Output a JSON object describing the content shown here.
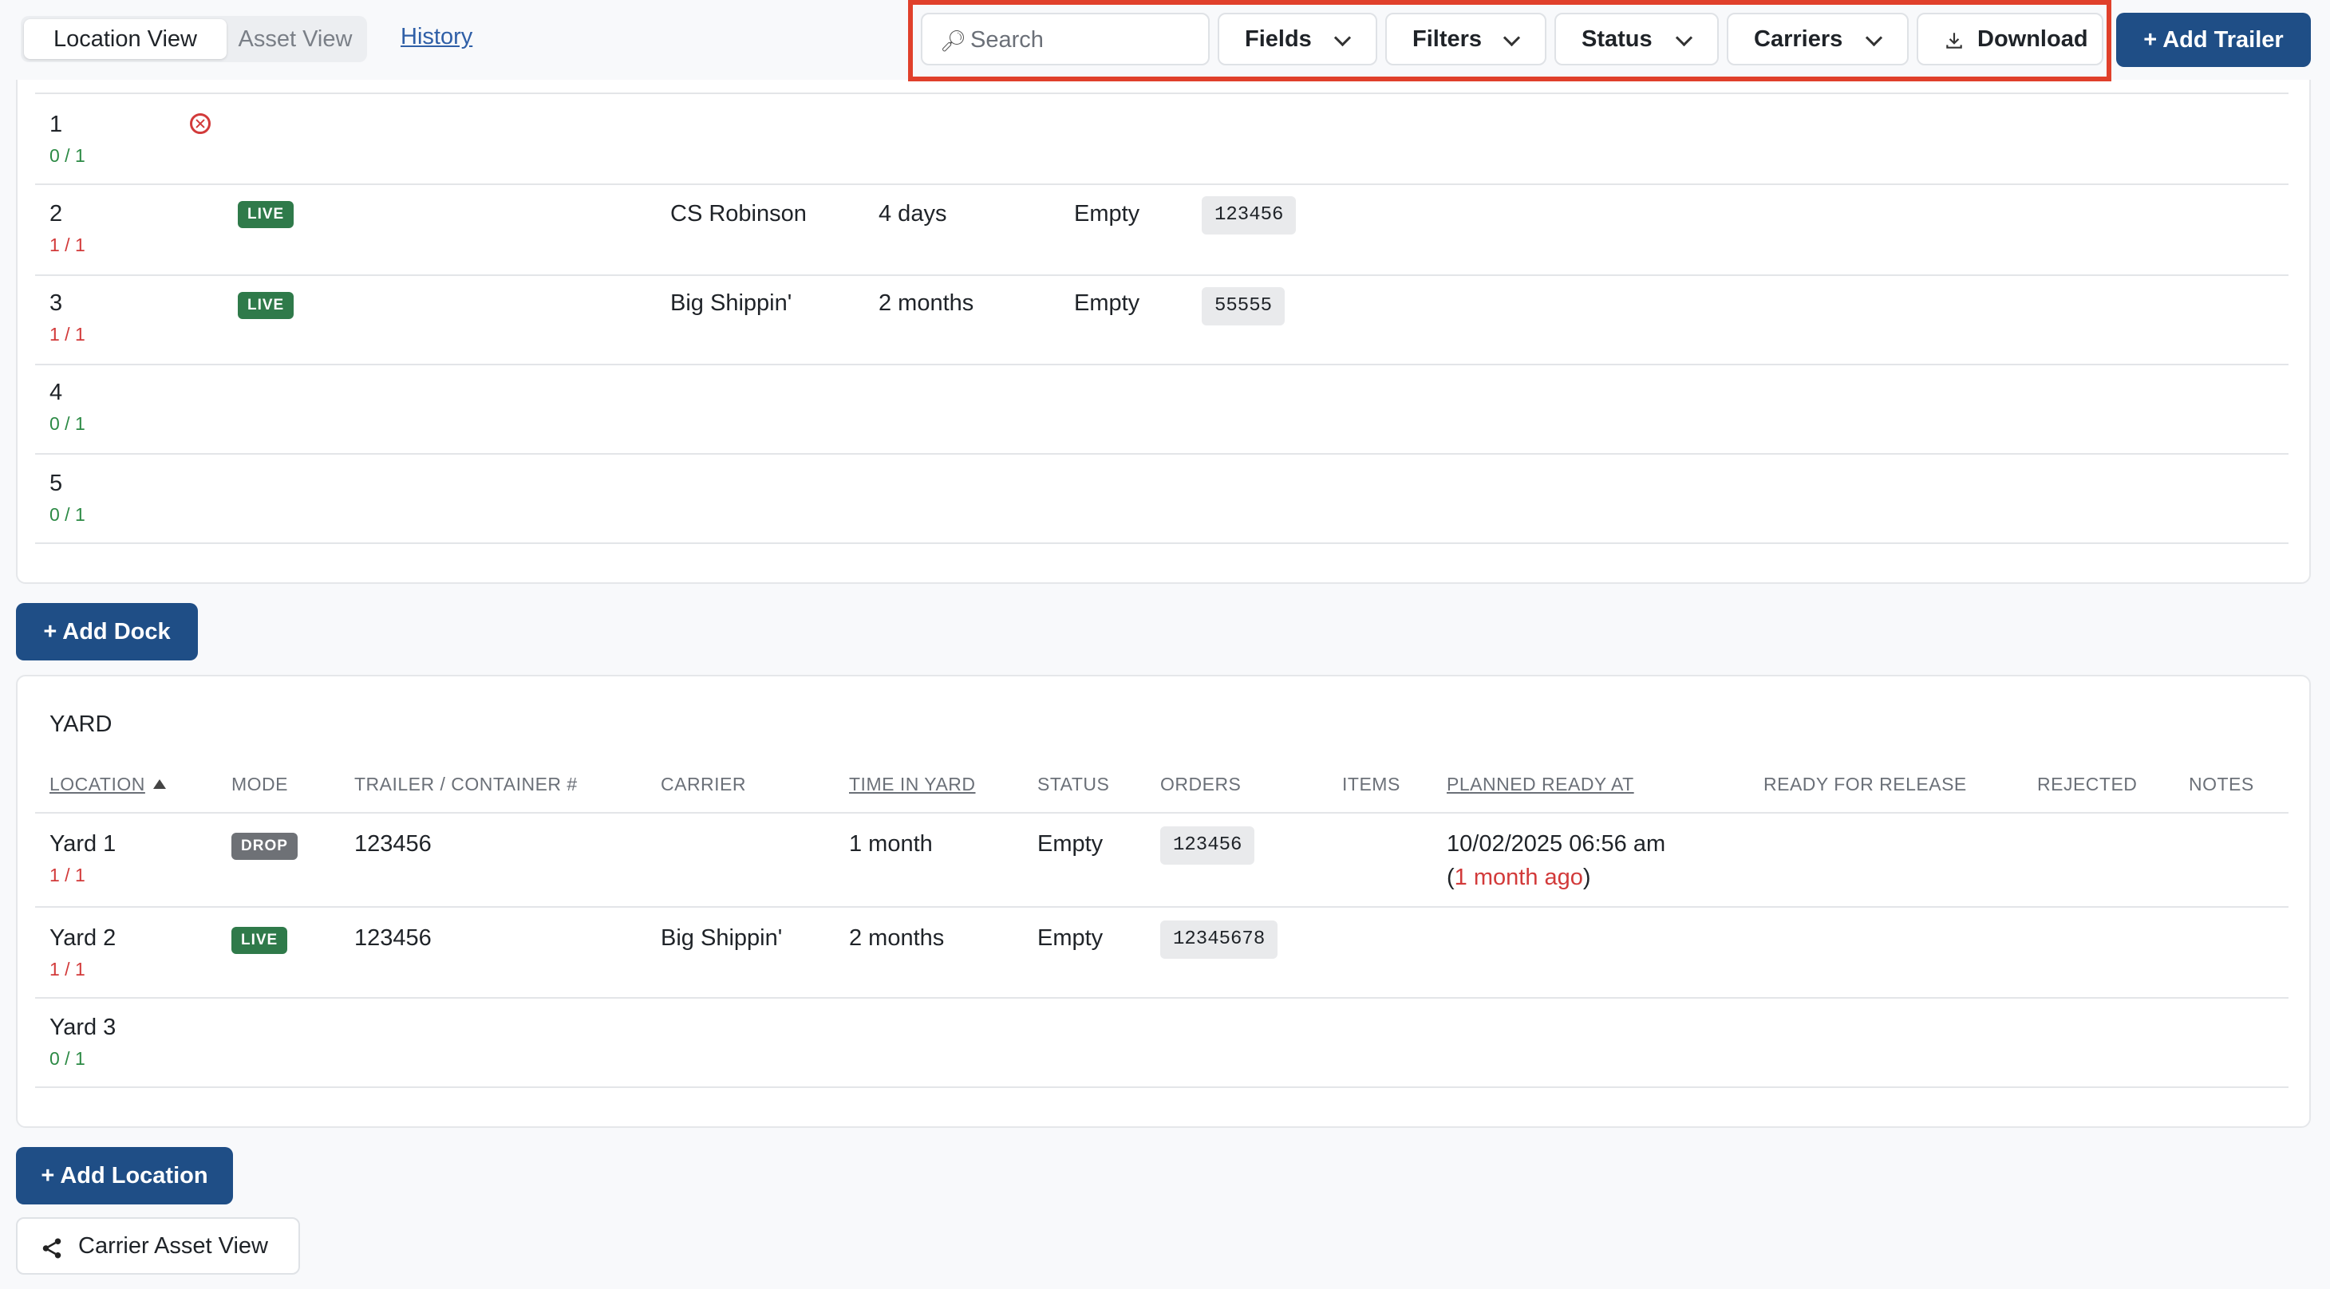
{
  "toolbar": {
    "view_tabs": [
      "Location View",
      "Asset View"
    ],
    "history_label": "History",
    "search_placeholder": "Search",
    "fields_label": "Fields",
    "filters_label": "Filters",
    "status_label": "Status",
    "carriers_label": "Carriers",
    "download_label": "Download",
    "add_trailer_label": "+ Add Trailer"
  },
  "docks": [
    {
      "location": "1",
      "occupancy": "0 / 1",
      "occupancy_color": "green",
      "status_icon": "error-circle-x-icon"
    },
    {
      "location": "2",
      "occupancy": "1 / 1",
      "occupancy_color": "red",
      "mode": "LIVE",
      "carrier": "CS Robinson",
      "time_in_yard": "4 days",
      "status": "Empty",
      "order": "123456"
    },
    {
      "location": "3",
      "occupancy": "1 / 1",
      "occupancy_color": "red",
      "mode": "LIVE",
      "carrier": "Big Shippin'",
      "time_in_yard": "2 months",
      "status": "Empty",
      "order": "55555"
    },
    {
      "location": "4",
      "occupancy": "0 / 1",
      "occupancy_color": "green"
    },
    {
      "location": "5",
      "occupancy": "0 / 1",
      "occupancy_color": "green"
    }
  ],
  "add_dock_label": "+ Add Dock",
  "yard": {
    "title": "YARD",
    "columns": [
      "LOCATION",
      "MODE",
      "TRAILER / CONTAINER #",
      "CARRIER",
      "TIME IN YARD",
      "STATUS",
      "ORDERS",
      "ITEMS",
      "PLANNED READY AT",
      "READY FOR RELEASE",
      "REJECTED",
      "NOTES"
    ],
    "rows": [
      {
        "location": "Yard 1",
        "occupancy": "1 / 1",
        "mode": "DROP",
        "trailer": "123456",
        "carrier": "",
        "time_in_yard": "1 month",
        "status": "Empty",
        "order": "123456",
        "planned_ready_at": "10/02/2025 06:56 am",
        "planned_ready_relative": "1 month ago"
      },
      {
        "location": "Yard 2",
        "occupancy": "1 / 1",
        "mode": "LIVE",
        "trailer": "123456",
        "carrier": "Big Shippin'",
        "time_in_yard": "2 months",
        "status": "Empty",
        "order": "12345678"
      },
      {
        "location": "Yard 3",
        "occupancy": "0 / 1"
      }
    ]
  },
  "add_location_label": "+ Add Location",
  "carrier_asset_view_label": "Carrier Asset View",
  "colors": {
    "primary": "#1f4e86",
    "live_badge": "#2f7a4a",
    "drop_badge": "#6e7176",
    "occupancy_free": "#2c8a45",
    "occupancy_full": "#d23a3a",
    "highlight_border": "#e0402b"
  }
}
